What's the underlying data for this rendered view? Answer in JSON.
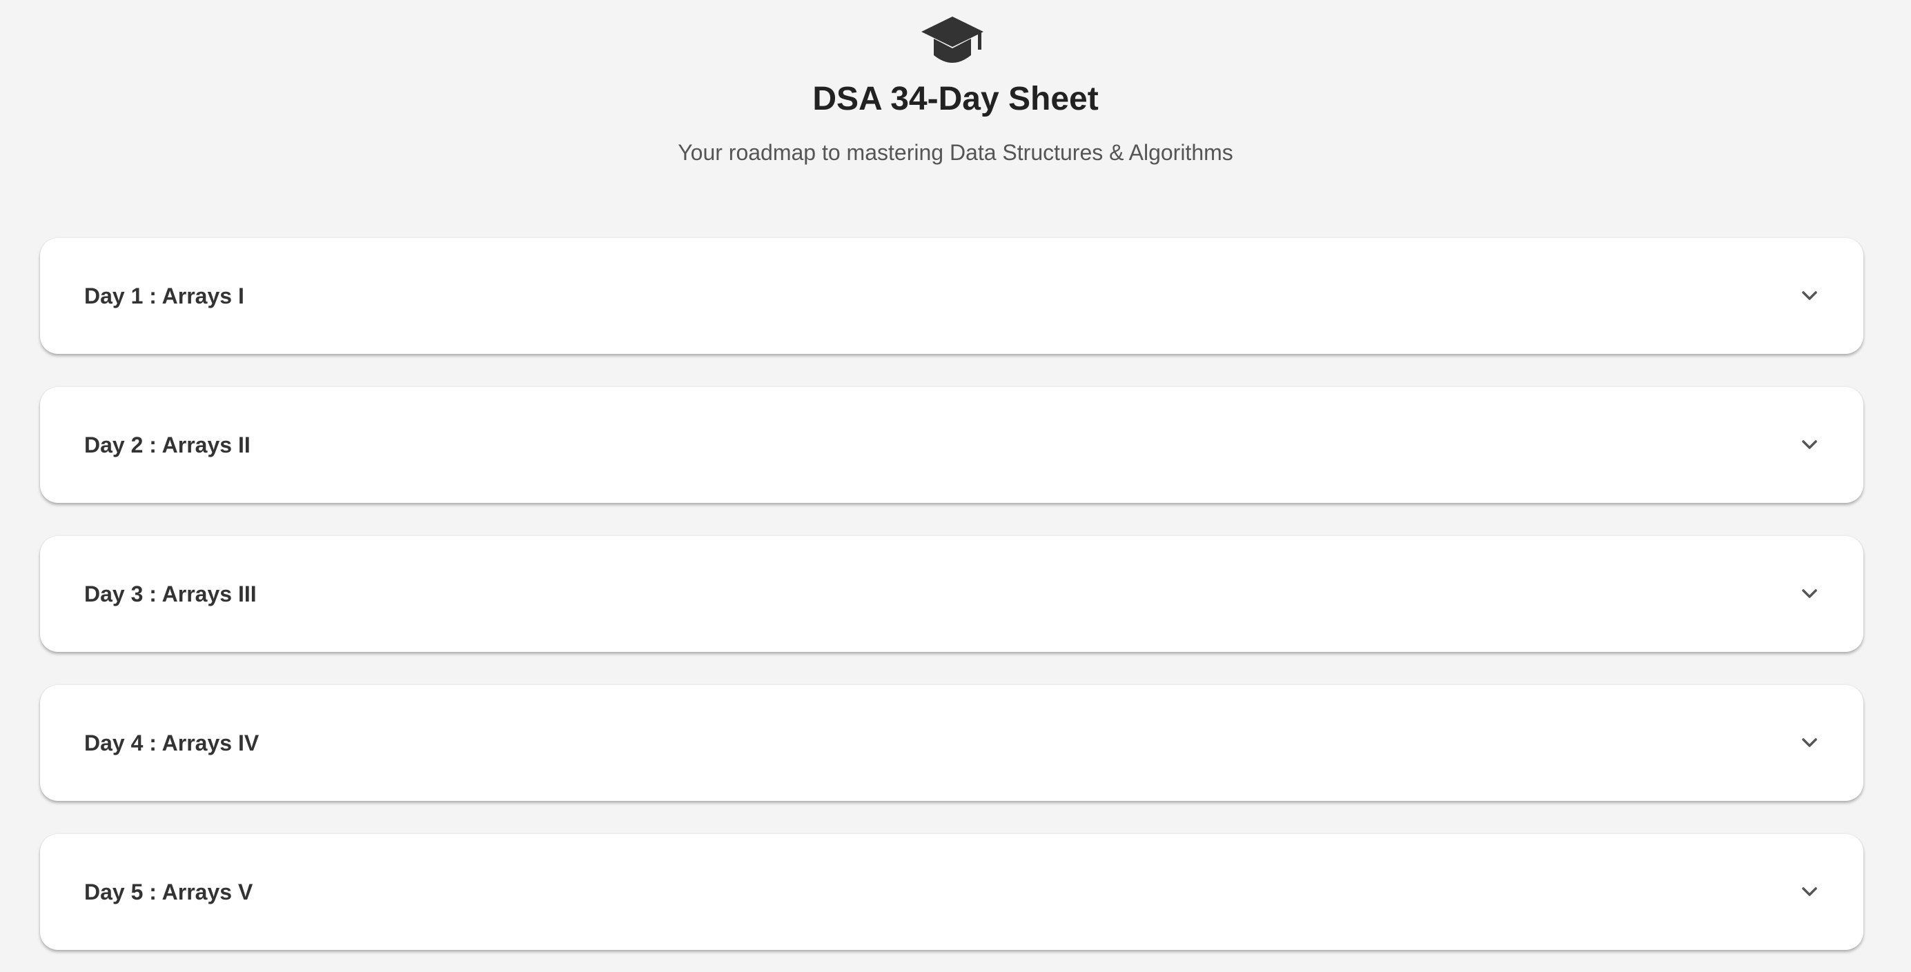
{
  "header": {
    "logo_icon": "graduation-cap-icon",
    "title": "DSA 34-Day Sheet",
    "subtitle": "Your roadmap to mastering Data Structures & Algorithms"
  },
  "days": [
    {
      "label": "Day 1 : Arrays I",
      "expanded": false
    },
    {
      "label": "Day 2 : Arrays II",
      "expanded": false
    },
    {
      "label": "Day 3 : Arrays III",
      "expanded": false
    },
    {
      "label": "Day 4 : Arrays IV",
      "expanded": false
    },
    {
      "label": "Day 5 : Arrays V",
      "expanded": false
    }
  ],
  "colors": {
    "background": "#f4f4f4",
    "card": "#ffffff",
    "title_text": "#222222",
    "subtitle_text": "#555555",
    "icon": "#333333"
  }
}
